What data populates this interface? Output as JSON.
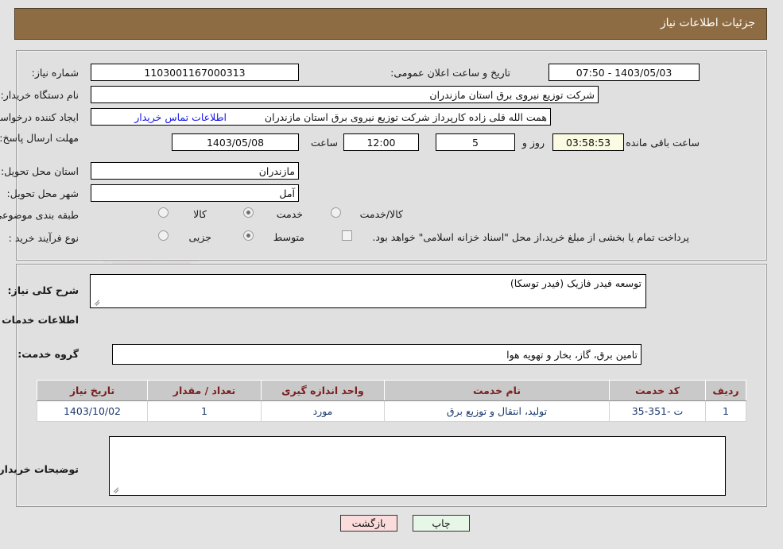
{
  "header": {
    "title": "جزئیات اطلاعات نیاز"
  },
  "top_form": {
    "need_number_label": "شماره نیاز:",
    "need_number_value": "1103001167000313",
    "public_announce_label": "تاریخ و ساعت اعلان عمومی:",
    "public_announce_value": "1403/05/03 - 07:50",
    "buyer_org_label": "نام دستگاه خریدار:",
    "buyer_org_value": "شرکت توزیع نیروی برق استان مازندران",
    "creator_label": "ایجاد کننده درخواست:",
    "creator_value": "همت الله قلی زاده کارپرداز شرکت توزیع نیروی برق استان مازندران",
    "contact_link": "اطلاعات تماس خریدار",
    "deadline_label": "مهلت ارسال پاسخ: تا تاریخ:",
    "deadline_date": "1403/05/08",
    "deadline_hour_label": "ساعت",
    "deadline_hour": "12:00",
    "days_remaining": "5",
    "days_unit_label": "روز و",
    "time_remaining": "03:58:53",
    "time_remaining_label": "ساعت باقی مانده",
    "province_label": "استان محل تحویل:",
    "province_value": "مازندران",
    "city_label": "شهر محل تحویل:",
    "city_value": "آمل",
    "category_label": "طبقه بندی موضوعی:",
    "category_options": [
      {
        "label": "کالا",
        "selected": false
      },
      {
        "label": "خدمت",
        "selected": true
      },
      {
        "label": "کالا/خدمت",
        "selected": false
      }
    ],
    "process_label": "نوع فرآیند خرید :",
    "process_options": [
      {
        "label": "جزیی",
        "selected": false
      },
      {
        "label": "متوسط",
        "selected": true
      }
    ],
    "treasury_checkbox_checked": false,
    "treasury_note": "پرداخت تمام یا بخشی از مبلغ خرید،از محل \"اسناد خزانه اسلامی\" خواهد بود."
  },
  "middle": {
    "general_desc_label": "شرح کلی نیاز:",
    "general_desc_value": "توسعه فیدر فازیک (فیدر توسکا)",
    "services_section_title": "اطلاعات خدمات مورد نیاز",
    "service_group_label": "گروه خدمت:",
    "service_group_value": "تامین برق، گاز، بخار و تهویه هوا",
    "buyer_notes_label": "توضیحات خریدار:",
    "buyer_notes_value": ""
  },
  "table": {
    "columns": [
      "ردیف",
      "کد خدمت",
      "نام خدمت",
      "واحد اندازه گیری",
      "تعداد / مقدار",
      "تاریخ نیاز"
    ],
    "rows": [
      {
        "row_no": "1",
        "service_code": "ت -351-35",
        "service_name": "تولید، انتقال و توزیع برق",
        "unit": "مورد",
        "quantity": "1",
        "need_date": "1403/10/02"
      }
    ]
  },
  "footer": {
    "print_label": "چاپ",
    "back_label": "بازگشت"
  },
  "colors": {
    "title_bar": "#8d6c44",
    "page_bg": "#e3e3e3",
    "panel_bg": "#e0e0e0",
    "link": "#1414ee",
    "table_header_bg": "#c9c9c9",
    "table_header_text": "#7b2020",
    "table_cell_text": "#1d3a6e",
    "print_button_bg": "#e7f7e7",
    "back_button_bg": "#fbdcdc",
    "timer_bg": "#fbfbe4"
  }
}
